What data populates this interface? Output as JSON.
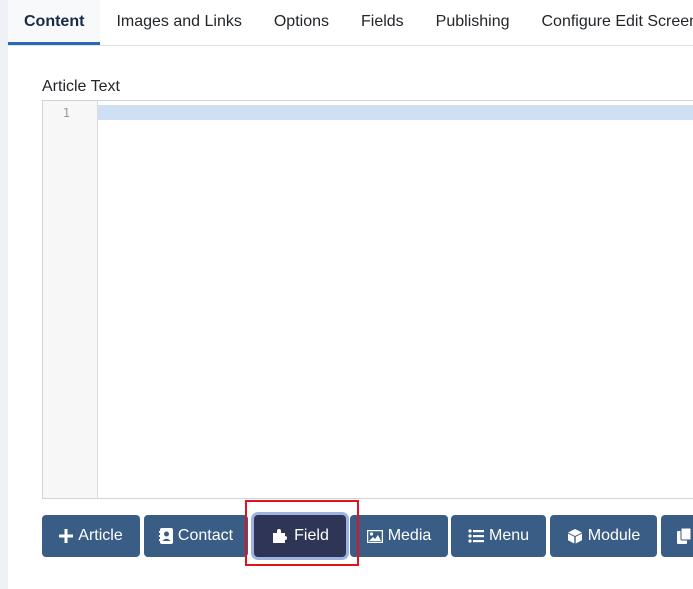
{
  "tabs": [
    {
      "label": "Content",
      "active": true
    },
    {
      "label": "Images and Links"
    },
    {
      "label": "Options"
    },
    {
      "label": "Fields"
    },
    {
      "label": "Publishing"
    },
    {
      "label": "Configure Edit Screen"
    }
  ],
  "editor": {
    "label": "Article Text",
    "line_number": "1"
  },
  "buttons": [
    {
      "label": "Article",
      "icon": "plus-icon"
    },
    {
      "label": "Contact",
      "icon": "address-card-icon"
    },
    {
      "label": "Field",
      "icon": "puzzle-piece-icon"
    },
    {
      "label": "Media",
      "icon": "image-icon"
    },
    {
      "label": "Menu",
      "icon": "list-icon"
    },
    {
      "label": "Module",
      "icon": "cube-icon"
    },
    {
      "label": "",
      "icon": "copy-icon"
    }
  ],
  "colors": {
    "button_bg": "#3a5d86",
    "active_button_bg": "#2f3655",
    "highlight_border": "#e0141c",
    "active_line": "#cfe0f5"
  }
}
